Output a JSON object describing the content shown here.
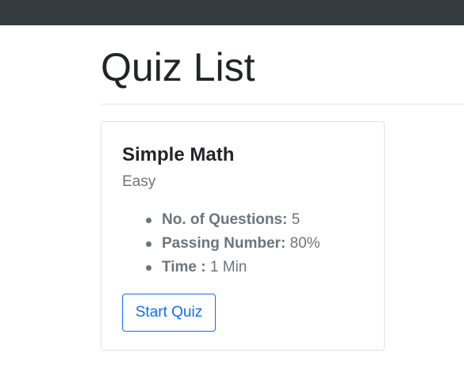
{
  "page": {
    "title": "Quiz List"
  },
  "colors": {
    "navbar": "#343a40",
    "accent": "#0d6efd",
    "muted_text": "#6c757d",
    "body_text": "#212529"
  },
  "quizzes": [
    {
      "title": "Simple Math",
      "difficulty": "Easy",
      "details": [
        {
          "label": "No. of Questions:",
          "value": "5"
        },
        {
          "label": "Passing Number:",
          "value": "80%"
        },
        {
          "label": "Time :",
          "value": "1 Min"
        }
      ],
      "action_label": "Start Quiz"
    }
  ]
}
